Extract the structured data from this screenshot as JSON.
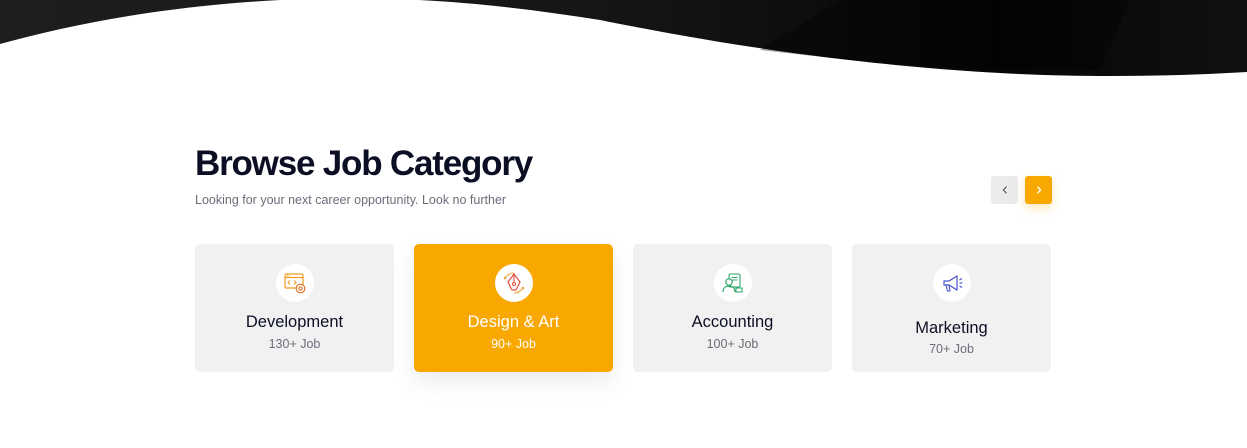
{
  "section": {
    "title": "Browse Job Category",
    "subtitle": "Looking for your next career opportunity. Look no further"
  },
  "carousel": {
    "prev_icon": "chevron-left-icon",
    "next_icon": "chevron-right-icon"
  },
  "categories": [
    {
      "name": "Development",
      "count": "130+ Job",
      "icon": "code-window-icon",
      "active": false
    },
    {
      "name": "Design & Art",
      "count": "90+ Job",
      "icon": "pen-tool-icon",
      "active": true
    },
    {
      "name": "Accounting",
      "count": "100+ Job",
      "icon": "accountant-icon",
      "active": false
    },
    {
      "name": "Marketing",
      "count": "70+ Job",
      "icon": "megaphone-icon",
      "active": false
    }
  ],
  "colors": {
    "accent": "#f8a800",
    "heading": "#0c0f24",
    "muted_text": "#6b6e7a",
    "card_background": "#f1f1f1",
    "hero_dark": "#0d0d0d"
  }
}
